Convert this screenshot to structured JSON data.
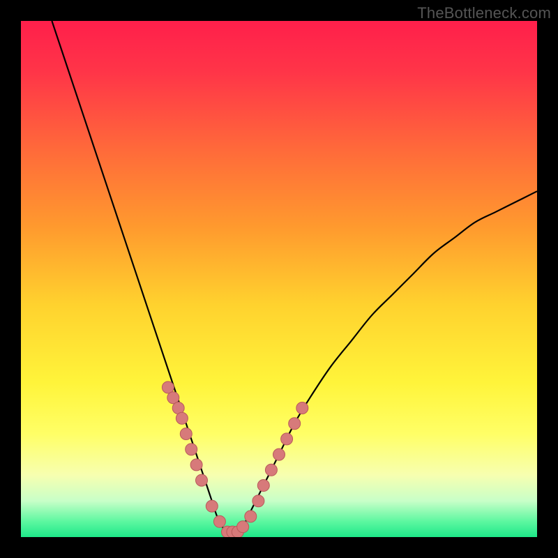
{
  "watermark": "TheBottleneck.com",
  "colors": {
    "frame": "#000000",
    "curve": "#000000",
    "markerFill": "#d77a7a",
    "markerStroke": "#b85a5a",
    "gradientStops": [
      {
        "offset": 0.0,
        "color": "#ff1f4b"
      },
      {
        "offset": 0.1,
        "color": "#ff3548"
      },
      {
        "offset": 0.25,
        "color": "#ff6a3a"
      },
      {
        "offset": 0.4,
        "color": "#ff9a2e"
      },
      {
        "offset": 0.55,
        "color": "#ffd22e"
      },
      {
        "offset": 0.7,
        "color": "#fff43a"
      },
      {
        "offset": 0.8,
        "color": "#ffff66"
      },
      {
        "offset": 0.88,
        "color": "#f7ffb0"
      },
      {
        "offset": 0.93,
        "color": "#c8ffc8"
      },
      {
        "offset": 0.97,
        "color": "#5cf7a0"
      },
      {
        "offset": 1.0,
        "color": "#1ee889"
      }
    ]
  },
  "chart_data": {
    "type": "line",
    "title": "",
    "xlabel": "",
    "ylabel": "",
    "xlim": [
      0,
      100
    ],
    "ylim": [
      0,
      100
    ],
    "series": [
      {
        "name": "bottleneck-curve",
        "x": [
          6,
          8,
          10,
          12,
          14,
          16,
          18,
          20,
          22,
          24,
          26,
          28,
          30,
          32,
          34,
          35,
          36,
          37,
          38,
          39,
          40,
          41,
          42,
          43,
          44,
          46,
          48,
          50,
          53,
          56,
          60,
          64,
          68,
          72,
          76,
          80,
          84,
          88,
          92,
          96,
          100
        ],
        "y": [
          100,
          94,
          88,
          82,
          76,
          70,
          64,
          58,
          52,
          46,
          40,
          34,
          28,
          22,
          16,
          13,
          10,
          7,
          4,
          2,
          1,
          1,
          1,
          2,
          4,
          8,
          12,
          16,
          22,
          27,
          33,
          38,
          43,
          47,
          51,
          55,
          58,
          61,
          63,
          65,
          67
        ]
      }
    ],
    "markers": {
      "name": "highlighted-points",
      "x": [
        28.5,
        29.5,
        30.5,
        31.2,
        32.0,
        33.0,
        34.0,
        35.0,
        37.0,
        38.5,
        40.0,
        41.0,
        42.0,
        43.0,
        44.5,
        46.0,
        47.0,
        48.5,
        50.0,
        51.5,
        53.0,
        54.5
      ],
      "y": [
        29,
        27,
        25,
        23,
        20,
        17,
        14,
        11,
        6,
        3,
        1,
        1,
        1,
        2,
        4,
        7,
        10,
        13,
        16,
        19,
        22,
        25
      ]
    }
  }
}
